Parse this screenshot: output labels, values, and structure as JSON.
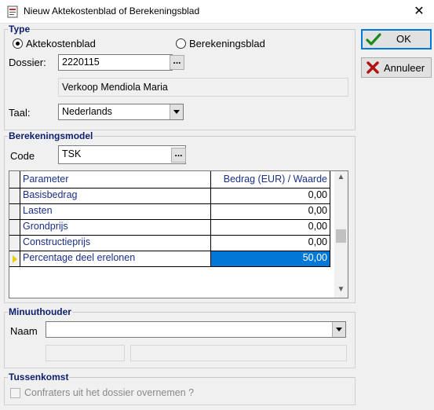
{
  "window": {
    "title": "Nieuw Aktekostenblad of Berekeningsblad",
    "close_glyph": "✕"
  },
  "type_group": {
    "legend": "Type",
    "radio_aktekosten": "Aktekostenblad",
    "radio_berekening": "Berekeningsblad",
    "selected": "Aktekostenblad"
  },
  "dossier": {
    "label": "Dossier:",
    "value": "2220115",
    "browse_label": "...",
    "name": "Verkoop Mendiola Maria"
  },
  "taal": {
    "label": "Taal:",
    "value": "Nederlands"
  },
  "berekeningsmodel": {
    "legend": "Berekeningsmodel",
    "code_label": "Code",
    "code_value": "TSK",
    "browse_label": "...",
    "grid": {
      "headers": [
        "Parameter",
        "Bedrag (EUR) / Waarde"
      ],
      "rows": [
        {
          "parameter": "Basisbedrag",
          "value": "0,00"
        },
        {
          "parameter": "Lasten",
          "value": "0,00"
        },
        {
          "parameter": "Grondprijs",
          "value": "0,00"
        },
        {
          "parameter": "Constructieprijs",
          "value": "0,00"
        },
        {
          "parameter": "Percentage deel erelonen",
          "value": "50,00"
        }
      ],
      "selected_row": 4
    }
  },
  "minuuthouder": {
    "legend": "Minuuthouder",
    "naam_label": "Naam",
    "naam_value": "",
    "field2": "",
    "field3": ""
  },
  "tussenkomst": {
    "legend": "Tussenkomst",
    "checkbox_label": "Confraters uit het dossier overnemen ?",
    "checked": false
  },
  "buttons": {
    "ok_label": "OK",
    "cancel_label": "Annuleer"
  },
  "colors": {
    "legend_text": "#0b1f6e",
    "selection": "#0078d7",
    "ok_check": "#1a8a1a",
    "cancel_x": "#b01010"
  }
}
